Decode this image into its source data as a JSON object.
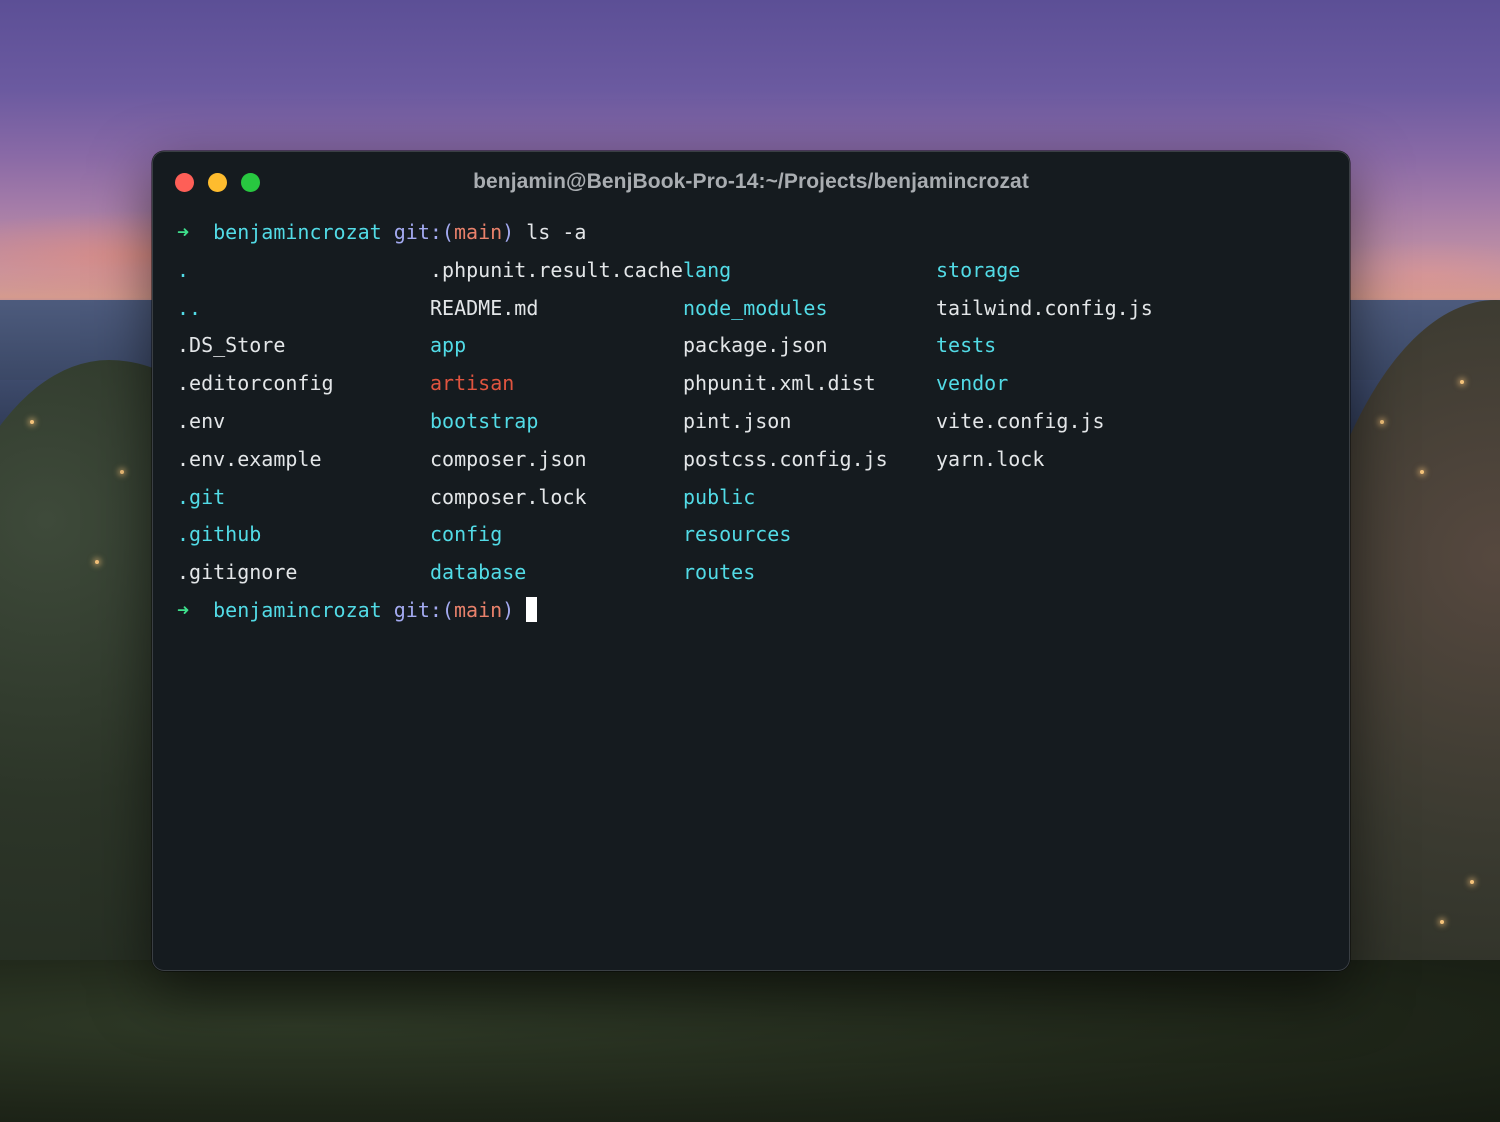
{
  "window": {
    "title": "benjamin@BenjBook-Pro-14:~/Projects/benjamincrozat"
  },
  "prompt": {
    "arrow": "➜",
    "directory": "benjamincrozat",
    "git_label": "git:(",
    "branch": "main",
    "git_close": ")"
  },
  "command": "ls -a",
  "listing": [
    [
      {
        "name": ".",
        "type": "dir"
      },
      {
        "name": ".phpunit.result.cache",
        "type": "file"
      },
      {
        "name": "lang",
        "type": "dir"
      },
      {
        "name": "storage",
        "type": "dir"
      }
    ],
    [
      {
        "name": "..",
        "type": "dir"
      },
      {
        "name": "README.md",
        "type": "file"
      },
      {
        "name": "node_modules",
        "type": "dir"
      },
      {
        "name": "tailwind.config.js",
        "type": "file"
      }
    ],
    [
      {
        "name": ".DS_Store",
        "type": "file"
      },
      {
        "name": "app",
        "type": "dir"
      },
      {
        "name": "package.json",
        "type": "file"
      },
      {
        "name": "tests",
        "type": "dir"
      }
    ],
    [
      {
        "name": ".editorconfig",
        "type": "file"
      },
      {
        "name": "artisan",
        "type": "exec"
      },
      {
        "name": "phpunit.xml.dist",
        "type": "file"
      },
      {
        "name": "vendor",
        "type": "dir"
      }
    ],
    [
      {
        "name": ".env",
        "type": "file"
      },
      {
        "name": "bootstrap",
        "type": "dir"
      },
      {
        "name": "pint.json",
        "type": "file"
      },
      {
        "name": "vite.config.js",
        "type": "file"
      }
    ],
    [
      {
        "name": ".env.example",
        "type": "file"
      },
      {
        "name": "composer.json",
        "type": "file"
      },
      {
        "name": "postcss.config.js",
        "type": "file"
      },
      {
        "name": "yarn.lock",
        "type": "file"
      }
    ],
    [
      {
        "name": ".git",
        "type": "dir"
      },
      {
        "name": "composer.lock",
        "type": "file"
      },
      {
        "name": "public",
        "type": "dir"
      },
      null
    ],
    [
      {
        "name": ".github",
        "type": "dir"
      },
      {
        "name": "config",
        "type": "dir"
      },
      {
        "name": "resources",
        "type": "dir"
      },
      null
    ],
    [
      {
        "name": ".gitignore",
        "type": "file"
      },
      {
        "name": "database",
        "type": "dir"
      },
      {
        "name": "routes",
        "type": "dir"
      },
      null
    ]
  ],
  "colors": {
    "terminal_bg": "#151b1f",
    "directory": "#52dbe6",
    "file": "#e3e6e8",
    "executable": "#e0543f",
    "prompt_arrow": "#3ee08c",
    "git_label": "#a3aaf0",
    "branch": "#e8816b",
    "close_button": "#fe5f57",
    "minimize_button": "#febc2e",
    "zoom_button": "#28c840"
  }
}
